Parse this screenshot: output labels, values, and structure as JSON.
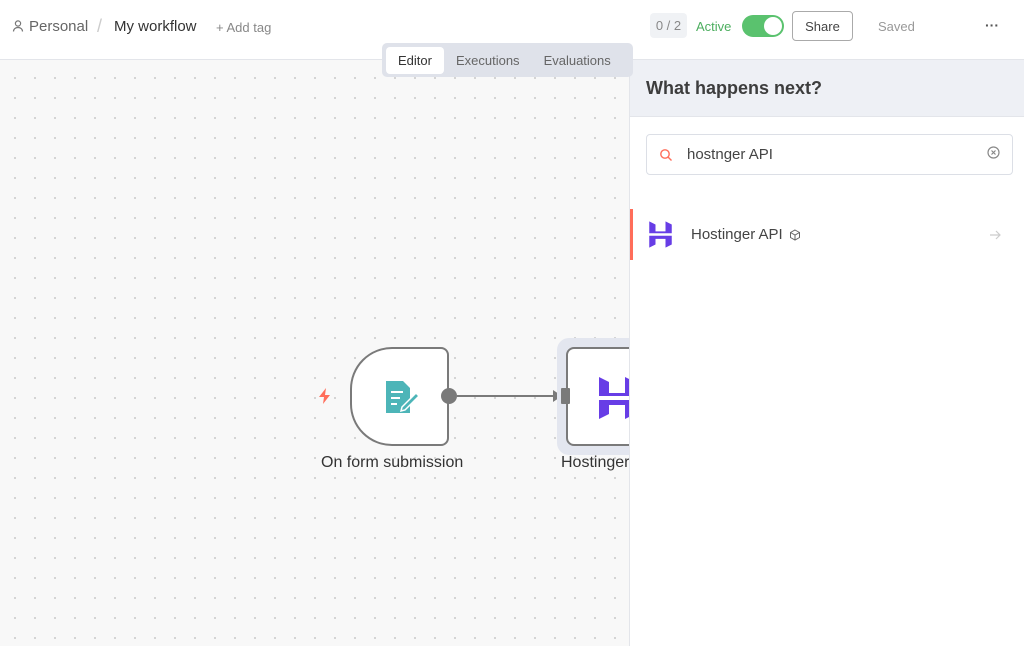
{
  "header": {
    "breadcrumb_project": "Personal",
    "separator": "/",
    "workflow_name": "My workflow",
    "add_tag": "+ Add tag",
    "counter": "0 / 2",
    "active_label": "Active",
    "active": true,
    "share": "Share",
    "saved": "Saved",
    "more": "···"
  },
  "tabs": [
    {
      "label": "Editor",
      "active": true
    },
    {
      "label": "Executions"
    },
    {
      "label": "Evaluations"
    }
  ],
  "canvas": {
    "nodes": [
      {
        "label": "On form submission",
        "icon": "form-icon",
        "trigger": true
      },
      {
        "label": "Hostinger API",
        "icon": "hostinger-logo"
      }
    ]
  },
  "panel": {
    "title": "What happens next?",
    "search_value": "hostnger API",
    "results": [
      {
        "label": "Hostinger API",
        "icon": "hostinger-logo",
        "badge": "cube-icon"
      }
    ]
  },
  "colors": {
    "accent": "#ff6d5a",
    "active_green": "#5ac26e",
    "hostinger": "#673de6",
    "form": "#4db5b8"
  }
}
